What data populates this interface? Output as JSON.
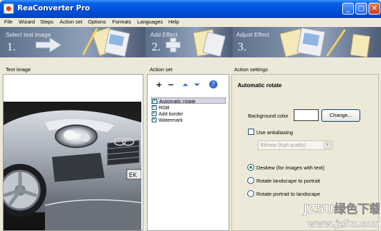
{
  "window": {
    "title": "ReaConverter Pro",
    "minimize": "_",
    "maximize": "□",
    "close": "✕"
  },
  "menu": [
    "File",
    "Wizard",
    "Steps",
    "Action set",
    "Options",
    "Formats",
    "Languages",
    "Help"
  ],
  "steps": [
    {
      "label": "Select test image",
      "number": "1."
    },
    {
      "label": "Add Effect",
      "number": "2."
    },
    {
      "label": "Adjust Effect",
      "number": "3."
    }
  ],
  "panes": {
    "test_image_title": "Test image",
    "action_set_title": "Action set",
    "action_settings_title": "Action settings"
  },
  "action_toolbar": {
    "add": "+",
    "remove": "−",
    "up": "⏶",
    "down": "⏷",
    "help": "?"
  },
  "actions": [
    {
      "label": "Automatic rotate",
      "checked": true,
      "selected": true
    },
    {
      "label": "RGB",
      "checked": true,
      "selected": false
    },
    {
      "label": "Add border",
      "checked": true,
      "selected": false
    },
    {
      "label": "Watermark",
      "checked": true,
      "selected": false
    }
  ],
  "settings": {
    "heading": "Automatic rotate",
    "background_color_label": "Background color",
    "background_color_value": "#ffffff",
    "change_button": "Change...",
    "antialiasing_label": "Use antialiasing",
    "antialiasing_checked": false,
    "filter_value": "Bilinear (high quality)",
    "radio_options": [
      {
        "label": "Deskew (for images with text)",
        "selected": true
      },
      {
        "label": "Rotate landscape to portrait",
        "selected": false
      },
      {
        "label": "Rotate portrait to landscape",
        "selected": false
      }
    ]
  },
  "watermark_text": {
    "brand": "JZ5U绿色下载",
    "url": "www.jz5u.com"
  },
  "colors": {
    "titlebar": "#0054e3",
    "banner": "#5e6f8a",
    "check": "#21a121"
  }
}
